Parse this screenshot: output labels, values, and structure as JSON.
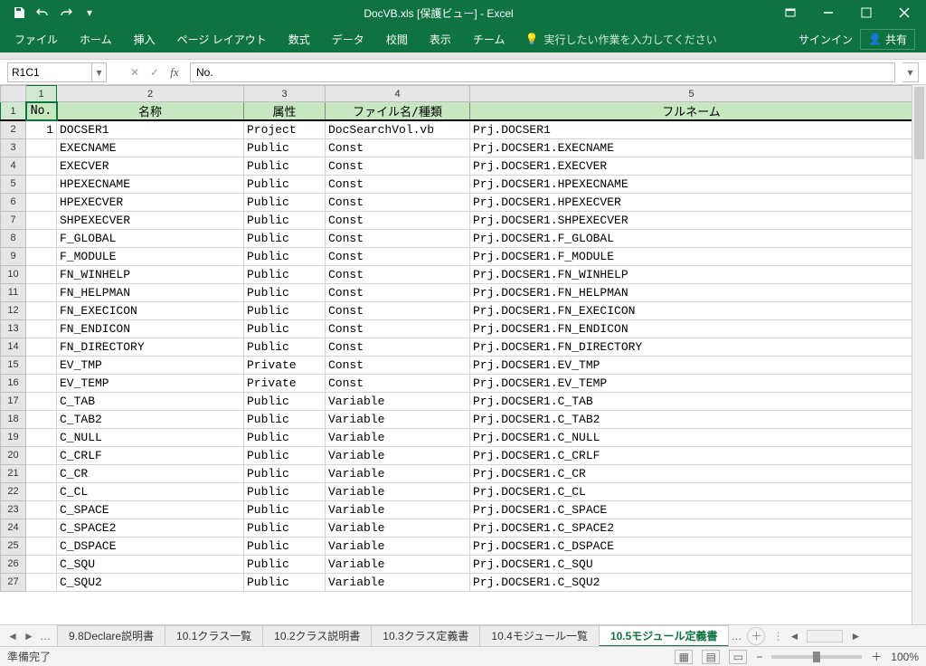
{
  "title": "DocVB.xls [保護ビュー] - Excel",
  "qat": {
    "save": "save-icon",
    "undo": "undo-icon",
    "redo": "redo-icon"
  },
  "ribbon": {
    "tabs": [
      "ファイル",
      "ホーム",
      "挿入",
      "ページ レイアウト",
      "数式",
      "データ",
      "校閲",
      "表示",
      "チーム"
    ],
    "tell_me": "実行したい作業を入力してください",
    "signin": "サインイン",
    "share": "共有"
  },
  "name_box": "R1C1",
  "formula": "No.",
  "col_headers": [
    "1",
    "2",
    "3",
    "4",
    "5"
  ],
  "header_row": {
    "no": "No.",
    "name": "名称",
    "attr": "属性",
    "file": "ファイル名/種類",
    "full": "フルネーム"
  },
  "rows": [
    {
      "r": "2",
      "no": "1",
      "name": "DOCSER1",
      "attr": "Project",
      "file": "DocSearchVol.vb",
      "full": "Prj.DOCSER1"
    },
    {
      "r": "3",
      "no": "",
      "name": "EXECNAME",
      "attr": "Public",
      "file": "Const",
      "full": "Prj.DOCSER1.EXECNAME"
    },
    {
      "r": "4",
      "no": "",
      "name": "EXECVER",
      "attr": "Public",
      "file": "Const",
      "full": "Prj.DOCSER1.EXECVER"
    },
    {
      "r": "5",
      "no": "",
      "name": "HPEXECNAME",
      "attr": "Public",
      "file": "Const",
      "full": "Prj.DOCSER1.HPEXECNAME"
    },
    {
      "r": "6",
      "no": "",
      "name": "HPEXECVER",
      "attr": "Public",
      "file": "Const",
      "full": "Prj.DOCSER1.HPEXECVER"
    },
    {
      "r": "7",
      "no": "",
      "name": "SHPEXECVER",
      "attr": "Public",
      "file": "Const",
      "full": "Prj.DOCSER1.SHPEXECVER"
    },
    {
      "r": "8",
      "no": "",
      "name": "F_GLOBAL",
      "attr": "Public",
      "file": "Const",
      "full": "Prj.DOCSER1.F_GLOBAL"
    },
    {
      "r": "9",
      "no": "",
      "name": "F_MODULE",
      "attr": "Public",
      "file": "Const",
      "full": "Prj.DOCSER1.F_MODULE"
    },
    {
      "r": "10",
      "no": "",
      "name": "FN_WINHELP",
      "attr": "Public",
      "file": "Const",
      "full": "Prj.DOCSER1.FN_WINHELP"
    },
    {
      "r": "11",
      "no": "",
      "name": "FN_HELPMAN",
      "attr": "Public",
      "file": "Const",
      "full": "Prj.DOCSER1.FN_HELPMAN"
    },
    {
      "r": "12",
      "no": "",
      "name": "FN_EXECICON",
      "attr": "Public",
      "file": "Const",
      "full": "Prj.DOCSER1.FN_EXECICON"
    },
    {
      "r": "13",
      "no": "",
      "name": "FN_ENDICON",
      "attr": "Public",
      "file": "Const",
      "full": "Prj.DOCSER1.FN_ENDICON"
    },
    {
      "r": "14",
      "no": "",
      "name": "FN_DIRECTORY",
      "attr": "Public",
      "file": "Const",
      "full": "Prj.DOCSER1.FN_DIRECTORY"
    },
    {
      "r": "15",
      "no": "",
      "name": "EV_TMP",
      "attr": "Private",
      "file": "Const",
      "full": "Prj.DOCSER1.EV_TMP"
    },
    {
      "r": "16",
      "no": "",
      "name": "EV_TEMP",
      "attr": "Private",
      "file": "Const",
      "full": "Prj.DOCSER1.EV_TEMP"
    },
    {
      "r": "17",
      "no": "",
      "name": "C_TAB",
      "attr": "Public",
      "file": "Variable",
      "full": "Prj.DOCSER1.C_TAB"
    },
    {
      "r": "18",
      "no": "",
      "name": "C_TAB2",
      "attr": "Public",
      "file": "Variable",
      "full": "Prj.DOCSER1.C_TAB2"
    },
    {
      "r": "19",
      "no": "",
      "name": "C_NULL",
      "attr": "Public",
      "file": "Variable",
      "full": "Prj.DOCSER1.C_NULL"
    },
    {
      "r": "20",
      "no": "",
      "name": "C_CRLF",
      "attr": "Public",
      "file": "Variable",
      "full": "Prj.DOCSER1.C_CRLF"
    },
    {
      "r": "21",
      "no": "",
      "name": "C_CR",
      "attr": "Public",
      "file": "Variable",
      "full": "Prj.DOCSER1.C_CR"
    },
    {
      "r": "22",
      "no": "",
      "name": "C_CL",
      "attr": "Public",
      "file": "Variable",
      "full": "Prj.DOCSER1.C_CL"
    },
    {
      "r": "23",
      "no": "",
      "name": "C_SPACE",
      "attr": "Public",
      "file": "Variable",
      "full": "Prj.DOCSER1.C_SPACE"
    },
    {
      "r": "24",
      "no": "",
      "name": "C_SPACE2",
      "attr": "Public",
      "file": "Variable",
      "full": "Prj.DOCSER1.C_SPACE2"
    },
    {
      "r": "25",
      "no": "",
      "name": "C_DSPACE",
      "attr": "Public",
      "file": "Variable",
      "full": "Prj.DOCSER1.C_DSPACE"
    },
    {
      "r": "26",
      "no": "",
      "name": "C_SQU",
      "attr": "Public",
      "file": "Variable",
      "full": "Prj.DOCSER1.C_SQU"
    },
    {
      "r": "27",
      "no": "",
      "name": "C_SQU2",
      "attr": "Public",
      "file": "Variable",
      "full": "Prj.DOCSER1.C_SQU2"
    }
  ],
  "sheet_tabs": [
    "9.8Declare説明書",
    "10.1クラス一覧",
    "10.2クラス説明書",
    "10.3クラス定義書",
    "10.4モジュール一覧",
    "10.5モジュール定義書"
  ],
  "active_sheet": 5,
  "status": {
    "ready": "準備完了",
    "zoom": "100%"
  }
}
